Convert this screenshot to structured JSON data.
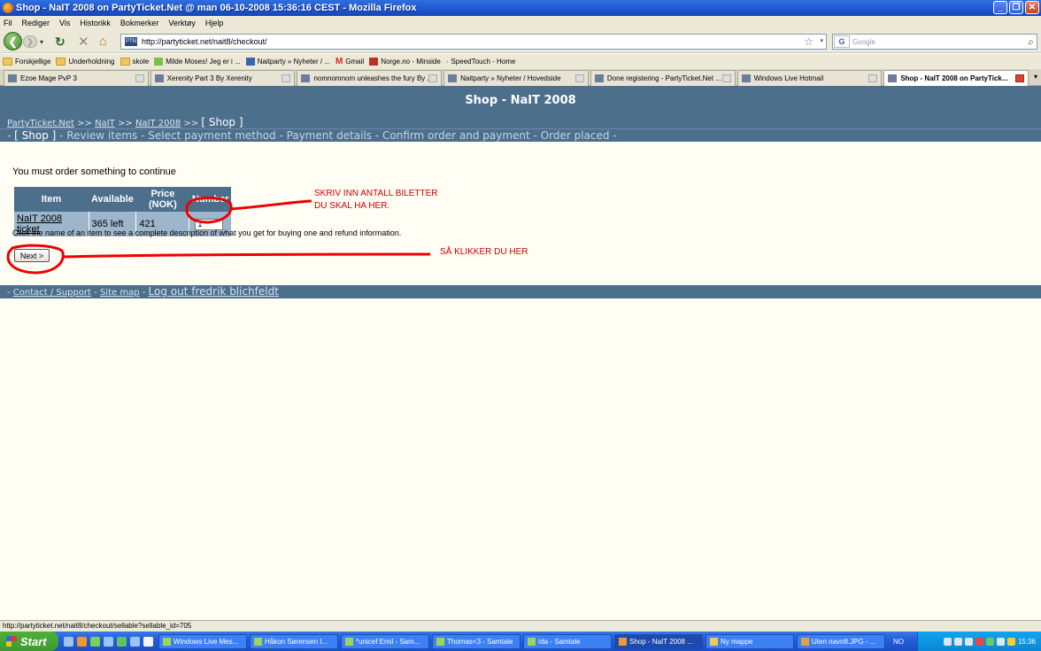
{
  "window": {
    "title": "Shop - NaIT 2008 on PartyTicket.Net @ man 06-10-2008 15:36:16 CEST - Mozilla Firefox"
  },
  "menu": [
    "Fil",
    "Rediger",
    "Vis",
    "Historikk",
    "Bokmerker",
    "Verktøy",
    "Hjelp"
  ],
  "toolbar": {
    "url": "http://partyticket.net/nait8/checkout/",
    "search_placeholder": "Google",
    "favicon_text": "PTN"
  },
  "bookmarks": [
    "Forskjellige",
    "Underholdning",
    "skole",
    "Milde Moses! Jeg er i ...",
    "Naitparty » Nyheter / ...",
    "Gmail",
    "Norge.no - Minside",
    "SpeedTouch - Home"
  ],
  "tabs": [
    {
      "label": "Ezoe Mage PvP 3"
    },
    {
      "label": "Xerenity Part 3 By Xerenity"
    },
    {
      "label": "nomnomnom unleashes the fury By ..."
    },
    {
      "label": "Naitparty » Nyheter / Hovedside"
    },
    {
      "label": "Done registering - PartyTicket.Net ..."
    },
    {
      "label": "Windows Live Hotmail"
    },
    {
      "label": "Shop - NaIT 2008 on PartyTick..."
    }
  ],
  "page": {
    "header": "Shop - NaIT 2008",
    "crumb": {
      "home": "PartyTicket.Net",
      "sep": ">>",
      "nait": "NaIT",
      "nait2008": "NaIT 2008",
      "current": "[ Shop ]"
    },
    "steps": {
      "lead": "- ",
      "current": "[ Shop ]",
      "rest": " - Review items - Select payment method - Payment details - Confirm order and payment - Order placed -"
    },
    "message": "You must order something to continue",
    "table": {
      "headers": [
        "Item",
        "Available",
        "Price (NOK)",
        "Number"
      ],
      "rows": [
        {
          "item": "NaIT 2008 ticket",
          "available": "365 left",
          "price": "421",
          "number": "1"
        }
      ]
    },
    "hint": "Click the name of an item to see a complete description of what you get for buying one and refund information.",
    "next_label": "Next >",
    "annotation1": [
      "SKRIV INN ANTALL BILETTER",
      "DU SKAL HA HER."
    ],
    "annotation2": "SÅ KLIKKER DU HER",
    "footer": {
      "dash": "-",
      "contact": "Contact / Support",
      "sitemap": "Site map",
      "logout": "Log out fredrik blichfeldt"
    }
  },
  "statusbar": "http://partyticket.net/nait8/checkout/sellable?sellable_id=705",
  "taskbar": {
    "start": "Start",
    "tasks": [
      "Windows Live Mes...",
      "Håkon Sørensen I...",
      "*unicef Emil - Sam...",
      "Thomas<3 - Samtale",
      "Ida - Samtale",
      "Shop - NaIT 2008 ...",
      "Ny mappe",
      "Uten navn8.JPG - ..."
    ],
    "lang": "NO",
    "clock": "15:36"
  },
  "colors": {
    "header_bg": "#4c6f8c",
    "table_cell_bg": "#9db6cc",
    "annotation_red": "#cc0000",
    "page_bg": "#fffdf4"
  }
}
